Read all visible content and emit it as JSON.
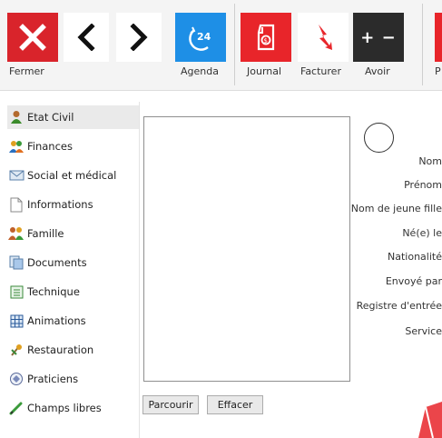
{
  "toolbar": {
    "buttons": [
      {
        "id": "fermer",
        "label": "Fermer",
        "icon": "close-icon",
        "color": "#d9242b"
      },
      {
        "id": "prev",
        "label": "",
        "icon": "chevron-left-icon"
      },
      {
        "id": "next",
        "label": "",
        "icon": "chevron-right-icon"
      },
      {
        "id": "agenda",
        "label": "Agenda",
        "icon": "agenda-24-icon",
        "color": "#1e8fe6",
        "badge": "24"
      },
      {
        "id": "journal",
        "label": "Journal",
        "icon": "journal-icon",
        "color": "#e8252a"
      },
      {
        "id": "facturer",
        "label": "Facturer",
        "icon": "lightning-icon",
        "color": "#e8252a"
      },
      {
        "id": "avoir",
        "label": "Avoir",
        "icon": "plus-minus-icon",
        "color": "#2b2b2b",
        "glyph": "+ −"
      },
      {
        "id": "partial",
        "label": "P",
        "icon": "partial-icon",
        "color": "#e8252a"
      }
    ]
  },
  "sidebar": {
    "items": [
      {
        "label": "Etat Civil",
        "icon": "person-icon",
        "active": true
      },
      {
        "label": "Finances",
        "icon": "people-coins-icon"
      },
      {
        "label": "Social et médical",
        "icon": "envelope-icon"
      },
      {
        "label": "Informations",
        "icon": "document-icon"
      },
      {
        "label": "Famille",
        "icon": "family-icon"
      },
      {
        "label": "Documents",
        "icon": "documents-icon"
      },
      {
        "label": "Technique",
        "icon": "list-icon"
      },
      {
        "label": "Animations",
        "icon": "grid-icon"
      },
      {
        "label": "Restauration",
        "icon": "restauration-icon"
      },
      {
        "label": "Praticiens",
        "icon": "praticiens-icon"
      },
      {
        "label": "Champs libres",
        "icon": "pen-icon"
      }
    ]
  },
  "main": {
    "browse_label": "Parcourir",
    "clear_label": "Effacer",
    "fields": [
      {
        "label": "Nom"
      },
      {
        "label": "Prénom"
      },
      {
        "label": "Nom de jeune fille"
      },
      {
        "label": "Né(e) le"
      },
      {
        "label": "Nationalité"
      },
      {
        "label": "Envoyé par"
      },
      {
        "label": "Registre d'entrée"
      },
      {
        "label": "Service"
      }
    ]
  },
  "colors": {
    "red": "#e8252a",
    "blue": "#1e8fe6",
    "dark": "#2b2b2b"
  }
}
